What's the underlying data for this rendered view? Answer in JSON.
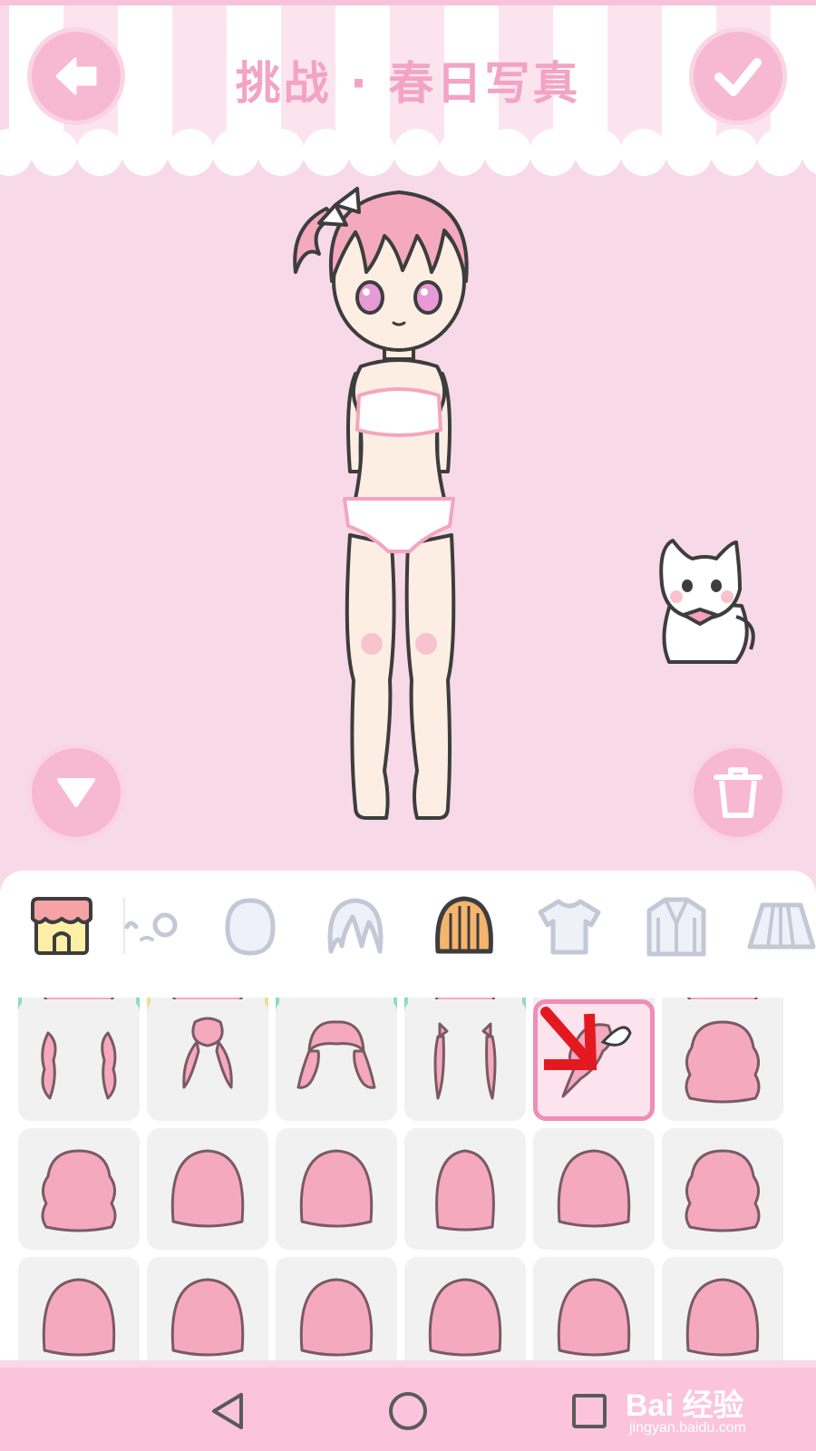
{
  "header": {
    "title": "挑战 · 春日写真",
    "back_icon": "arrow-left-icon",
    "confirm_icon": "check-icon"
  },
  "stage": {
    "collapse_icon": "triangle-down-icon",
    "delete_icon": "trash-icon",
    "pet": "white-cat-with-bow"
  },
  "tabs": [
    {
      "name": "shop",
      "icon": "shop-icon"
    },
    {
      "name": "face",
      "icon": "face-icon"
    },
    {
      "name": "head",
      "icon": "head-icon"
    },
    {
      "name": "front-hair",
      "icon": "hair-front-icon"
    },
    {
      "name": "back-hair",
      "icon": "hair-back-icon",
      "active": true
    },
    {
      "name": "top",
      "icon": "tshirt-icon"
    },
    {
      "name": "jacket",
      "icon": "jacket-icon"
    },
    {
      "name": "skirt",
      "icon": "skirt-icon"
    }
  ],
  "selected_item": "side-ponytail-hair",
  "colors": {
    "accent": "#f08db5",
    "background": "#f8d9e8",
    "hair": "#f5a9bf",
    "navbar": "#fbc4dc"
  },
  "navbar": {
    "back_icon": "triangle-back-icon",
    "home_icon": "circle-home-icon",
    "recents_icon": "square-recents-icon"
  },
  "watermark": {
    "brand": "Bai 经验",
    "url": "jingyan.baidu.com"
  }
}
